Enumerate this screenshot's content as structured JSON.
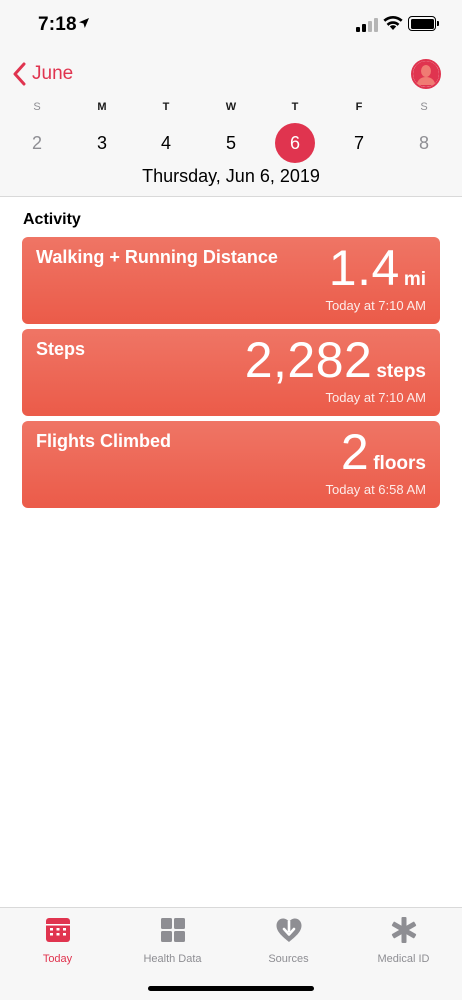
{
  "status_bar": {
    "time": "7:18"
  },
  "header": {
    "back_label": "June",
    "weekdays": [
      "S",
      "M",
      "T",
      "W",
      "T",
      "F",
      "S"
    ],
    "dates": [
      "2",
      "3",
      "4",
      "5",
      "6",
      "7",
      "8"
    ],
    "selected_date": "6",
    "full_date": "Thursday, Jun 6, 2019"
  },
  "activity": {
    "title": "Activity",
    "cards": [
      {
        "title": "Walking + Running Distance",
        "value": "1.4",
        "unit": "mi",
        "time": "Today at 7:10 AM"
      },
      {
        "title": "Steps",
        "value": "2,282",
        "unit": "steps",
        "time": "Today at 7:10 AM"
      },
      {
        "title": "Flights Climbed",
        "value": "2",
        "unit": "floors",
        "time": "Today at 6:58 AM"
      }
    ]
  },
  "tabs": [
    {
      "label": "Today",
      "icon": "calendar-icon",
      "active": true
    },
    {
      "label": "Health Data",
      "icon": "grid-icon",
      "active": false
    },
    {
      "label": "Sources",
      "icon": "heart-download-icon",
      "active": false
    },
    {
      "label": "Medical ID",
      "icon": "asterisk-icon",
      "active": false
    }
  ],
  "colors": {
    "accent": "#e0344f",
    "card_top": "#ef7565",
    "card_bottom": "#eb5b49",
    "inactive": "#8e8e93"
  }
}
